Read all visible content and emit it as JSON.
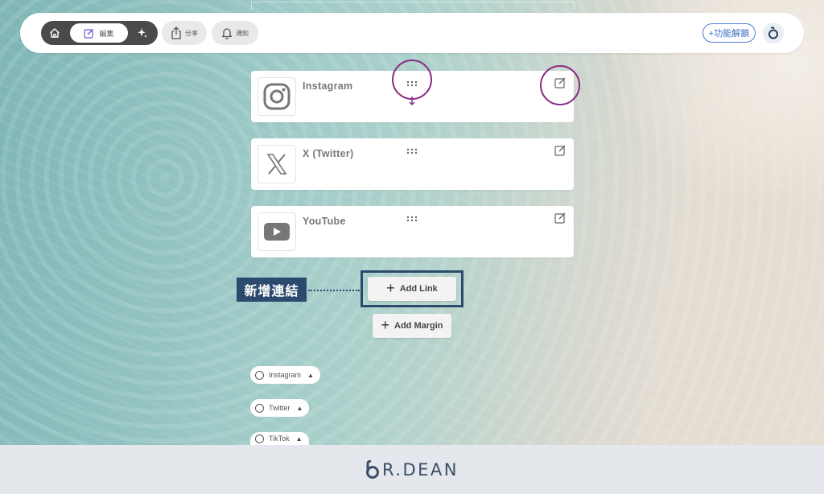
{
  "topbar": {
    "edit_label": "編集",
    "share_label": "分享",
    "notify_label": "通知",
    "unlock_label": "+功能解鎖"
  },
  "links": [
    {
      "title": "Instagram",
      "icon": "instagram-icon"
    },
    {
      "title": "X (Twitter)",
      "icon": "x-twitter-icon"
    },
    {
      "title": "YouTube",
      "icon": "youtube-icon"
    }
  ],
  "annotation": {
    "label": "新增連結"
  },
  "actions": {
    "add_link": "Add Link",
    "add_margin": "Add Margin"
  },
  "chips": [
    {
      "label": "Instagram"
    },
    {
      "label": "Twitter"
    },
    {
      "label": "TikTok"
    }
  ],
  "footer": {
    "brand_rest": "R.DEAN"
  },
  "colors": {
    "highlight": "#8a2a82",
    "annotation": "#2c4a6e",
    "accent": "#4a7fd0"
  }
}
